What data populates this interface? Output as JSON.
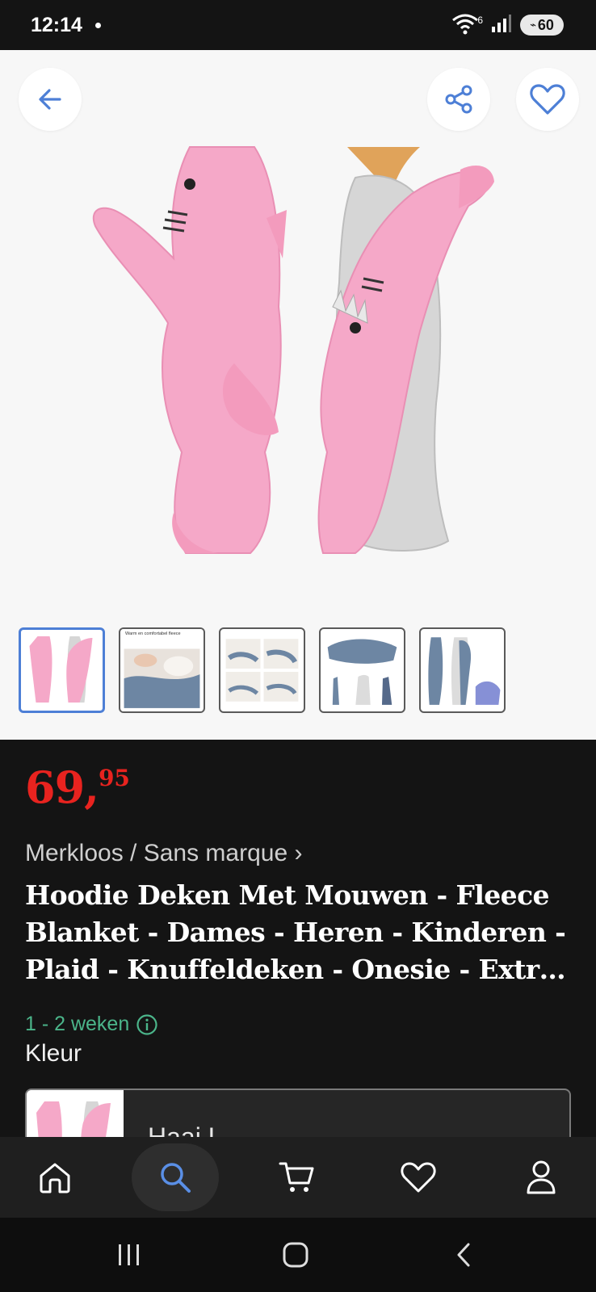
{
  "status_bar": {
    "time": "12:14",
    "battery": "60",
    "wifi_badge": "6"
  },
  "product": {
    "price_main": "69,",
    "price_cents": "95",
    "brand": "Merkloos / Sans marque ›",
    "title": "Hoodie Deken Met Mouwen - Fleece Blanket - Dames - Heren - Kinderen - Plaid - Knuffeldeken - Onesie - Extra Groot - Haai L",
    "delivery": "1 - 2 weken",
    "color_label": "Kleur",
    "color_variant": "Haai L"
  },
  "thumbnails": [
    {
      "caption": ""
    },
    {
      "caption": "Warm en comfortabel fleece"
    },
    {
      "caption": ""
    },
    {
      "caption": ""
    },
    {
      "caption": ""
    }
  ],
  "colors": {
    "price": "#e8231f",
    "accent_blue": "#4d7fd6",
    "delivery_green": "#4bb58a",
    "shark_pink": "#f5a8c8"
  },
  "icons": {
    "back": "arrow-left-icon",
    "share": "share-icon",
    "favorite": "heart-icon",
    "nav": [
      "home-icon",
      "search-icon",
      "cart-icon",
      "heart-icon",
      "user-icon"
    ],
    "system": [
      "recent-apps-icon",
      "home-circle-icon",
      "back-chevron-icon"
    ]
  }
}
